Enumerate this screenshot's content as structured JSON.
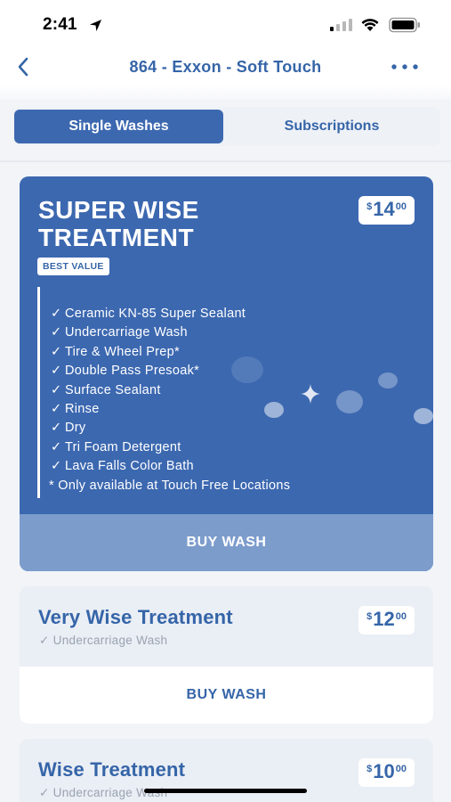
{
  "status_bar": {
    "time": "2:41"
  },
  "header": {
    "title": "864 - Exxon - Soft Touch"
  },
  "tabs": [
    {
      "label": "Single Washes",
      "active": true
    },
    {
      "label": "Subscriptions",
      "active": false
    }
  ],
  "featured": {
    "title_line1": "SUPER WISE",
    "title_line2": "TREATMENT",
    "badge": "BEST VALUE",
    "price": {
      "currency": "$",
      "amount": "14",
      "cents": "00"
    },
    "check": "✓",
    "features": [
      "Ceramic KN-85 Super Sealant",
      "Undercarriage Wash",
      "Tire & Wheel Prep*",
      "Double Pass Presoak*",
      "Surface Sealant",
      "Rinse",
      "Dry",
      "Tri Foam Detergent",
      "Lava Falls Color Bath"
    ],
    "note": "* Only available at Touch Free Locations",
    "buy_label": "BUY WASH"
  },
  "washes": [
    {
      "title": "Very Wise Treatment",
      "subtitle": "✓ Undercarriage Wash",
      "price": {
        "currency": "$",
        "amount": "12",
        "cents": "00"
      },
      "buy_label": "BUY WASH"
    },
    {
      "title": "Wise Treatment",
      "subtitle": "✓ Undercarriage Wash",
      "price": {
        "currency": "$",
        "amount": "10",
        "cents": "00"
      }
    }
  ],
  "icons": {
    "back": "chevron-left-icon",
    "more": "more-horizontal-icon",
    "location": "location-arrow-icon",
    "signal": "cellular-signal-icon",
    "wifi": "wifi-icon",
    "battery": "battery-icon",
    "sparkle": "sparkle-icon"
  },
  "colors": {
    "brand_blue": "#3c68b0",
    "title_blue": "#3565a8",
    "buy_featured_bg": "#7c9ccc",
    "card_bg": "#eaeef5",
    "muted_text": "#9aa3b0"
  }
}
